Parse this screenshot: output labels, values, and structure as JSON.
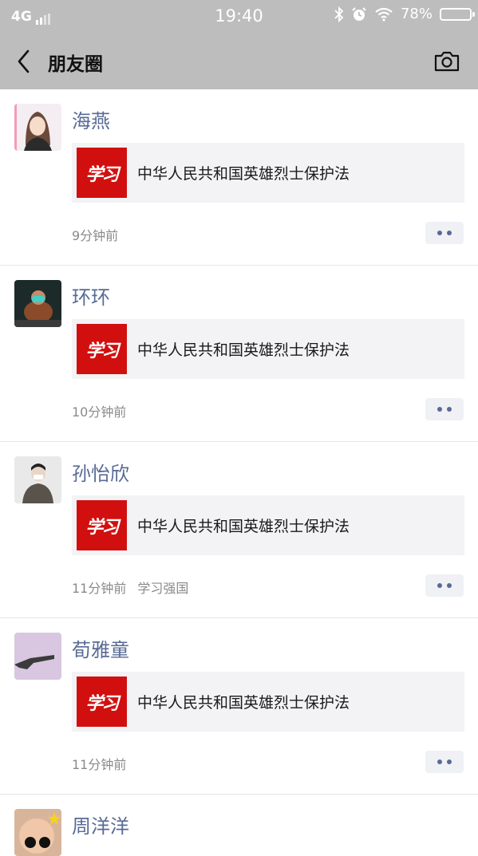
{
  "status_bar": {
    "network": "4G",
    "time": "19:40",
    "battery": "78%"
  },
  "nav": {
    "title": "朋友圈"
  },
  "posts": [
    {
      "name": "海燕",
      "thumb_text": "学习",
      "title": "中华人民共和国英雄烈士保护法",
      "time": "9分钟前",
      "source": ""
    },
    {
      "name": "环环",
      "thumb_text": "学习",
      "title": "中华人民共和国英雄烈士保护法",
      "time": "10分钟前",
      "source": ""
    },
    {
      "name": "孙怡欣",
      "thumb_text": "学习",
      "title": "中华人民共和国英雄烈士保护法",
      "time": "11分钟前",
      "source": "学习强国"
    },
    {
      "name": "荀雅童",
      "thumb_text": "学习",
      "title": "中华人民共和国英雄烈士保护法",
      "time": "11分钟前",
      "source": ""
    },
    {
      "name": "周洋洋"
    }
  ],
  "icons": {
    "back": "back-arrow-icon",
    "camera": "camera-icon",
    "bluetooth": "bluetooth-icon",
    "alarm": "alarm-icon",
    "wifi": "wifi-icon",
    "battery": "battery-icon",
    "signal": "signal-icon",
    "more": "more-dots-icon"
  },
  "colors": {
    "bar": "#bdbdbd",
    "name": "#586b95",
    "thumb": "#d20f0f",
    "card": "#f3f3f5"
  }
}
